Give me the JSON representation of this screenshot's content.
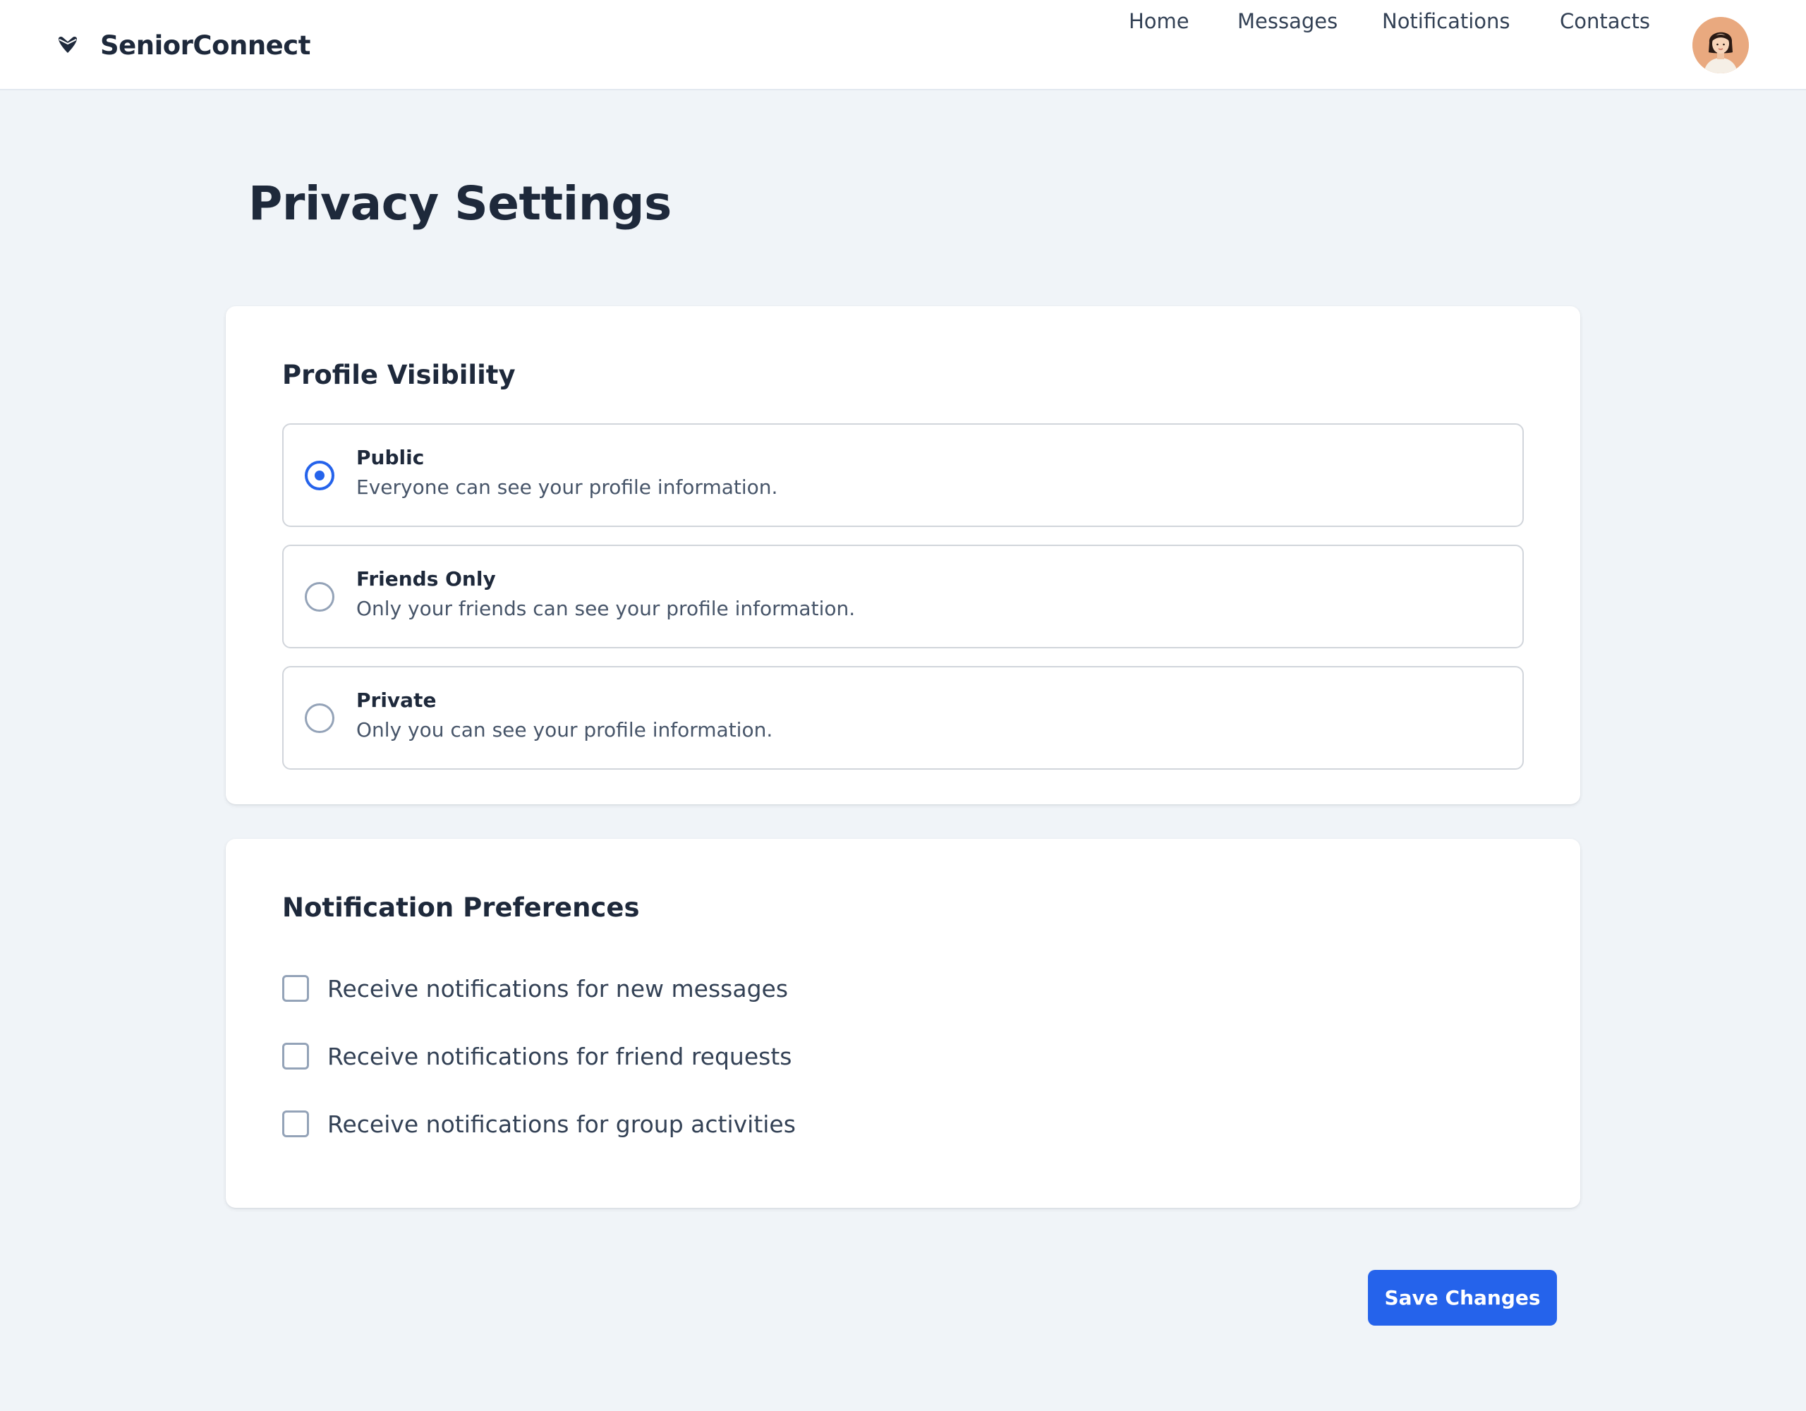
{
  "header": {
    "brand_name": "SeniorConnect",
    "brand_icon": "heart-icon",
    "nav": [
      {
        "label": "Home"
      },
      {
        "label": "Messages"
      },
      {
        "label": "Notifications"
      },
      {
        "label": "Contacts"
      }
    ],
    "avatar_icon": "user-avatar"
  },
  "page": {
    "title": "Privacy Settings"
  },
  "profile_visibility": {
    "title": "Profile Visibility",
    "selected": "Public",
    "options": [
      {
        "label": "Public",
        "description": "Everyone can see your profile information."
      },
      {
        "label": "Friends Only",
        "description": "Only your friends can see your profile information."
      },
      {
        "label": "Private",
        "description": "Only you can see your profile information."
      }
    ]
  },
  "notification_preferences": {
    "title": "Notification Preferences",
    "items": [
      {
        "label": "Receive notifications for new messages",
        "checked": false
      },
      {
        "label": "Receive notifications for friend requests",
        "checked": false
      },
      {
        "label": "Receive notifications for group activities",
        "checked": false
      }
    ]
  },
  "actions": {
    "save_label": "Save Changes"
  },
  "colors": {
    "accent": "#2563eb",
    "background": "#f0f4f8",
    "text": "#1e293b",
    "border": "#d1d5db"
  }
}
